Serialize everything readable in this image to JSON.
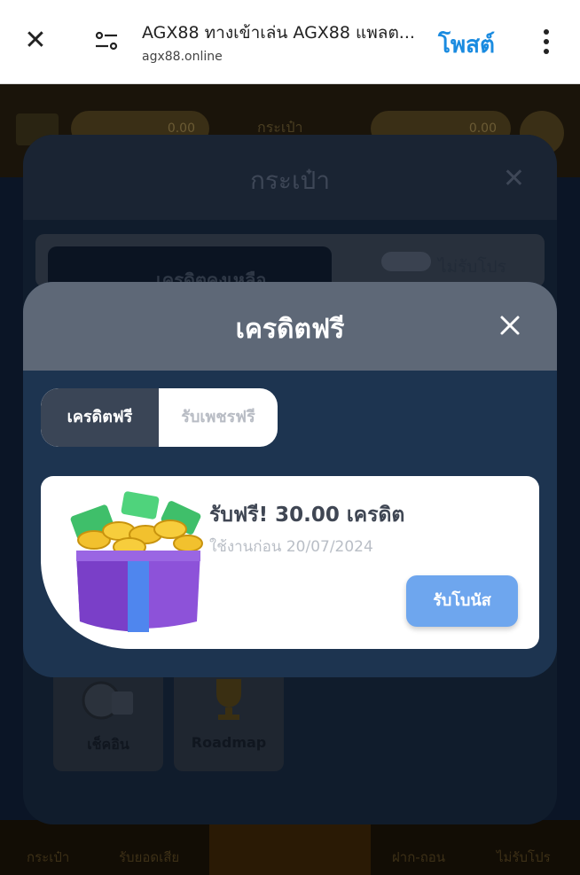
{
  "browser": {
    "title": "AGX88 ทางเข้าเล่น AGX88 แพลต...",
    "url": "agx88.online",
    "post_label": "โพสต์"
  },
  "background": {
    "balance_left": "0.00",
    "balance_right": "0.00",
    "center_text": "กระเป๋า",
    "footer_items": [
      "กระเป๋า",
      "รับยอดเสีย",
      "ฝาก-ถอน",
      "ไม่รับโปร"
    ]
  },
  "wallet": {
    "title": "กระเป๋า",
    "credit_label": "เครดิตคงเหลือ",
    "no_promo_label": "ไม่รับโปร",
    "tiles": [
      "เช็คอิน",
      "Roadmap"
    ]
  },
  "free_credit": {
    "title": "เครดิตฟรี",
    "tabs": [
      "เครดิตฟรี",
      "รับเพชรฟรี"
    ],
    "bonus": {
      "title": "รับฟรี! 30.00 เครดิต",
      "expiry": "ใช้งานก่อน 20/07/2024",
      "button": "รับโบนัส"
    }
  },
  "colors": {
    "modal_bg": "#1d3450",
    "modal_header": "#5e6877",
    "button": "#6ea6ee",
    "browser_accent": "#1a8be0"
  }
}
